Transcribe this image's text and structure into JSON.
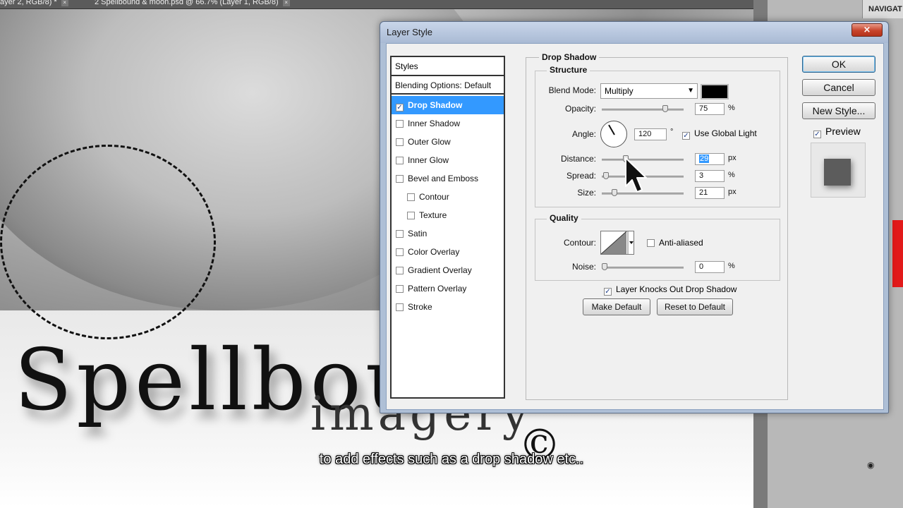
{
  "tabs": [
    {
      "label": "ayer 2, RGB/8) *"
    },
    {
      "label": "2 Spellbound & moon.psd @ 66.7% (Layer 1, RGB/8)"
    }
  ],
  "right_panel": {
    "navigator_label": "NAVIGAT"
  },
  "canvas": {
    "title_text": "Spellbou",
    "sub_text": "imagery",
    "symbol": "©"
  },
  "subtitle": "to add effects such as a drop shadow etc..",
  "dialog": {
    "title": "Layer Style",
    "close_symbol": "×",
    "styles_header": "Styles",
    "blending": "Blending Options: Default",
    "styles": [
      {
        "label": "Drop Shadow",
        "checked": true,
        "active": true
      },
      {
        "label": "Inner Shadow",
        "checked": false
      },
      {
        "label": "Outer Glow",
        "checked": false
      },
      {
        "label": "Inner Glow",
        "checked": false
      },
      {
        "label": "Bevel and Emboss",
        "checked": false
      },
      {
        "label": "Contour",
        "checked": false
      },
      {
        "label": "Texture",
        "checked": false
      },
      {
        "label": "Satin",
        "checked": false
      },
      {
        "label": "Color Overlay",
        "checked": false
      },
      {
        "label": "Gradient Overlay",
        "checked": false
      },
      {
        "label": "Pattern Overlay",
        "checked": false
      },
      {
        "label": "Stroke",
        "checked": false
      }
    ],
    "section_title": "Drop Shadow",
    "structure": {
      "legend": "Structure",
      "blend_mode_label": "Blend Mode:",
      "blend_mode_value": "Multiply",
      "shadow_color": "#000000",
      "opacity_label": "Opacity:",
      "opacity_value": "75",
      "opacity_unit": "%",
      "angle_label": "Angle:",
      "angle_value": "120",
      "angle_unit": "°",
      "global_light_label": "Use Global Light",
      "global_light_checked": true,
      "distance_label": "Distance:",
      "distance_value": "29",
      "distance_unit": "px",
      "spread_label": "Spread:",
      "spread_value": "3",
      "spread_unit": "%",
      "size_label": "Size:",
      "size_value": "21",
      "size_unit": "px"
    },
    "quality": {
      "legend": "Quality",
      "contour_label": "Contour:",
      "anti_aliased_label": "Anti-aliased",
      "anti_aliased_checked": false,
      "noise_label": "Noise:",
      "noise_value": "0",
      "noise_unit": "%"
    },
    "knocks_out_label": "Layer Knocks Out Drop Shadow",
    "knocks_out_checked": true,
    "make_default": "Make Default",
    "reset_default": "Reset to Default",
    "ok": "OK",
    "cancel": "Cancel",
    "new_style": "New Style...",
    "preview_label": "Preview",
    "preview_checked": true
  }
}
